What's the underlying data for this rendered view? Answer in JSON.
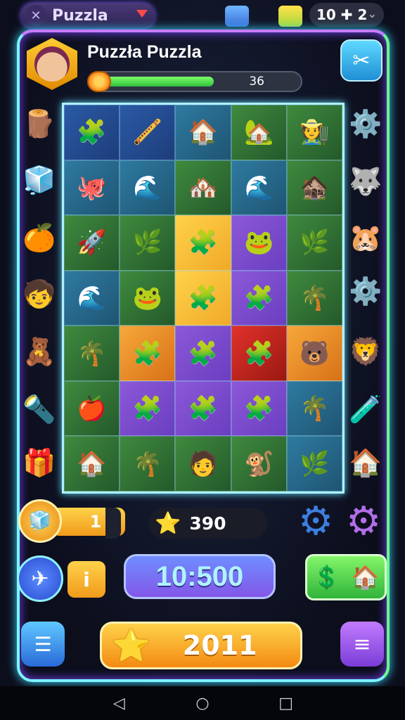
{
  "app": {
    "name": "Puzzla",
    "logo_icon": "✕",
    "top_counter": "10 ✚ 2"
  },
  "player": {
    "name": "Puzzła Puzzla",
    "xp_value": "36",
    "xp_progress": 0.52
  },
  "board": {
    "rows": [
      [
        "🧩",
        "🪈",
        "🏠",
        "🏡",
        "🧑‍🌾"
      ],
      [
        "🐙",
        "🌊",
        "🏘️",
        "🌊",
        "🏚️"
      ],
      [
        "🚀",
        "🌿",
        "🧩",
        "🐸",
        "🌿"
      ],
      [
        "🌊",
        "🐸",
        "🧩",
        "🧩",
        "🌴"
      ],
      [
        "🌴",
        "🧩",
        "🧩",
        "🧩",
        "🐻"
      ],
      [
        "🍎",
        "🧩",
        "🧩",
        "🧩",
        "🌴"
      ],
      [
        "🏠",
        "🌴",
        "🧑",
        "🐒",
        "🌿"
      ]
    ],
    "colors": [
      [
        "blue",
        "blue",
        "sea",
        "grass",
        "grass"
      ],
      [
        "sea",
        "sea",
        "grass",
        "sea",
        "grass"
      ],
      [
        "grass",
        "grass",
        "yellow",
        "purp",
        "grass"
      ],
      [
        "sea",
        "grass",
        "yellow",
        "purp",
        "grass"
      ],
      [
        "grass",
        "orange",
        "purp",
        "red",
        "orange"
      ],
      [
        "grass",
        "purp",
        "purp",
        "purp",
        "sea"
      ],
      [
        "grass",
        "grass",
        "grass",
        "grass",
        "sea"
      ]
    ]
  },
  "left_items": [
    "🪵",
    "🧊",
    "🍊",
    "🧒",
    "🧸",
    "🔦",
    "🎁"
  ],
  "right_items": [
    "⚙️",
    "🐺",
    "🐹",
    "⚙️",
    "🦁",
    "🧪",
    "🏠"
  ],
  "lives": {
    "icon": "🧊",
    "count": "1"
  },
  "score": {
    "icon": "⭐",
    "value": "390"
  },
  "timer": "10:500",
  "info_label": "i",
  "play_button": {
    "icon": "⭐",
    "value": "2011"
  },
  "icons": {
    "tool": "✂",
    "rocket": "✈",
    "shop": "💲",
    "shop_house": "🏠",
    "menu_left": "☰",
    "menu_right": "≡",
    "gear1": "⚙",
    "gear2": "⚙"
  },
  "nav": {
    "back": "◁",
    "home": "○",
    "recent": "□"
  }
}
